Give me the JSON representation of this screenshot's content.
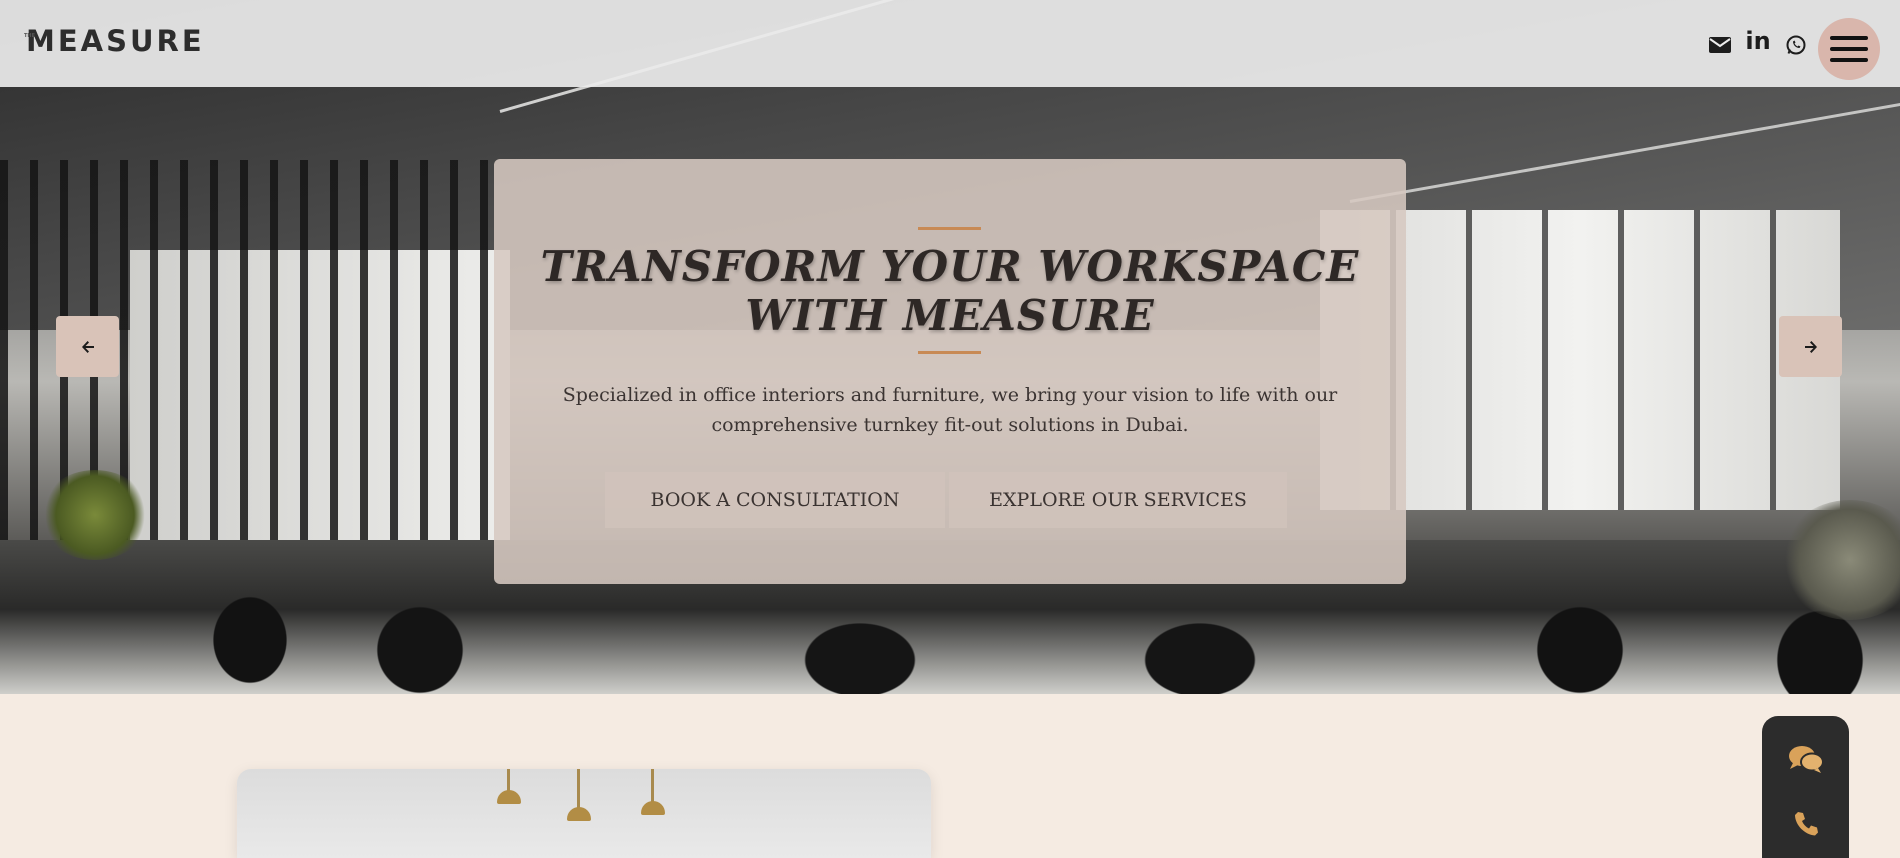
{
  "header": {
    "logo_small": "THE",
    "logo": "MEASURE",
    "social": [
      {
        "icon": "envelope-icon"
      },
      {
        "icon": "linkedin-icon",
        "glyph": "in"
      },
      {
        "icon": "whatsapp-icon"
      }
    ],
    "menu_icon": "hamburger-menu-icon"
  },
  "hero": {
    "title_line1": "TRANSFORM YOUR WORKSPACE",
    "title_line2": "WITH MEASURE",
    "description_line1": "Specialized in office interiors and furniture, we bring your vision to life with our",
    "description_line2": "comprehensive turnkey fit-out solutions in Dubai.",
    "primary_button": "BOOK A CONSULTATION",
    "secondary_button": "EXPLORE OUR SERVICES",
    "prev_icon": "arrow-left-icon",
    "next_icon": "arrow-right-icon"
  },
  "floating_contact": {
    "chat_icon": "chat-bubbles-icon",
    "phone_icon": "phone-icon"
  },
  "colors": {
    "accent": "#c88a55",
    "menu_bg": "#d9b6ac",
    "page_bg": "#f5ebe2",
    "float_bg": "#2c2c2c",
    "gold_icon": "#d9a25a"
  }
}
